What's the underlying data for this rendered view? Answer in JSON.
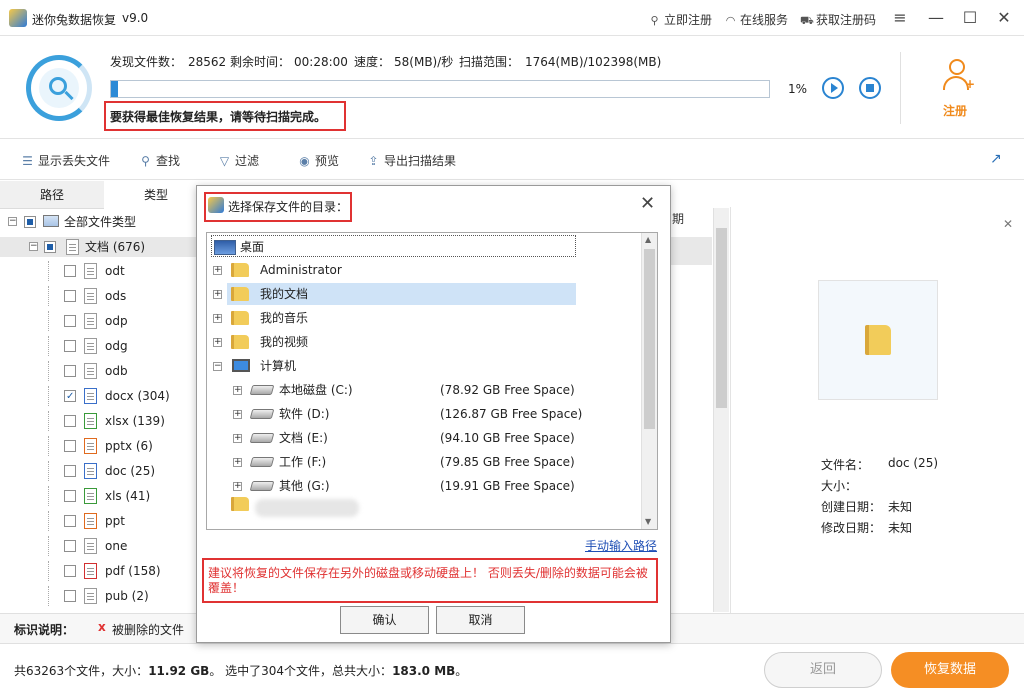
{
  "app": {
    "title": "迷你兔数据恢复",
    "version": "v9.0",
    "links": {
      "register_now": "立即注册",
      "online_service": "在线服务",
      "get_code": "获取注册码"
    },
    "icons": {
      "register": "search-icon",
      "service": "headset-icon",
      "cart": "cart-icon"
    }
  },
  "scan": {
    "found_label": "发现文件数：",
    "found_value": "28562",
    "remaining_label": "剩余时间：",
    "remaining_value": "00:28:00",
    "speed_label": "速度：",
    "speed_value": "58(MB)/秒",
    "range_label": "扫描范围：",
    "range_value": "1764(MB)/102398(MB)",
    "progress": 1,
    "progress_text": "1%",
    "warning": "要获得最佳恢复结果，请等待扫描完成。",
    "register_label": "注册"
  },
  "toolbar": {
    "show_lost": "显示丢失文件",
    "find": "查找",
    "filter": "过滤",
    "preview": "预览",
    "export": "导出扫描结果"
  },
  "tabs": [
    "路径",
    "类型"
  ],
  "tree": {
    "root": "全部文件类型",
    "docs": "文档 (676)",
    "items": [
      {
        "label": "odt",
        "color": "plain",
        "checked": false
      },
      {
        "label": "ods",
        "color": "plain",
        "checked": false
      },
      {
        "label": "odp",
        "color": "plain",
        "checked": false
      },
      {
        "label": "odg",
        "color": "plain",
        "checked": false
      },
      {
        "label": "odb",
        "color": "plain",
        "checked": false
      },
      {
        "label": "docx (304)",
        "color": "blue",
        "checked": true
      },
      {
        "label": "xlsx (139)",
        "color": "green",
        "checked": false
      },
      {
        "label": "pptx (6)",
        "color": "orange",
        "checked": false
      },
      {
        "label": "doc (25)",
        "color": "blue",
        "checked": false
      },
      {
        "label": "xls (41)",
        "color": "green",
        "checked": false
      },
      {
        "label": "ppt",
        "color": "orange",
        "checked": false
      },
      {
        "label": "one",
        "color": "plain",
        "checked": false
      },
      {
        "label": "pdf (158)",
        "color": "red",
        "checked": false
      },
      {
        "label": "pub (2)",
        "color": "plain",
        "checked": false
      }
    ]
  },
  "list": {
    "date_header": "日期"
  },
  "preview": {
    "name_label": "文件名：",
    "name_value": "doc (25)",
    "size_label": "大小：",
    "created_label": "创建日期：",
    "created_value": "未知",
    "modified_label": "修改日期：",
    "modified_value": "未知"
  },
  "legend": {
    "title": "标识说明：",
    "mark": "x",
    "text": "被删除的文件"
  },
  "status": {
    "total_prefix": "共63263个文件，大小：",
    "total_size": "11.92 GB",
    "selected_text": "。 选中了304个文件，总共大小：",
    "selected_size": "183.0 MB",
    "end": "。"
  },
  "buttons": {
    "back": "返回",
    "recover": "恢复数据"
  },
  "colors": {
    "accent": "#2d8ad6",
    "warn": "#e03232",
    "orange": "#f58e24"
  },
  "dialog": {
    "title": "选择保存文件的目录：",
    "desktop": "桌面",
    "admin": "Administrator",
    "my_docs": "我的文档",
    "my_music": "我的音乐",
    "my_videos": "我的视频",
    "computer": "计算机",
    "drives": [
      {
        "name": "本地磁盘 (C:)",
        "free": "(78.92 GB Free Space)"
      },
      {
        "name": "软件 (D:)",
        "free": "(126.87 GB Free Space)"
      },
      {
        "name": "文档 (E:)",
        "free": "(94.10 GB Free Space)"
      },
      {
        "name": "工作 (F:)",
        "free": "(79.85 GB Free Space)"
      },
      {
        "name": "其他 (G:)",
        "free": "(19.91 GB Free Space)"
      }
    ],
    "manual_path": "手动输入路径",
    "tip": "建议将恢复的文件保存在另外的磁盘或移动硬盘上！ 否则丢失/删除的数据可能会被覆盖！",
    "confirm": "确认",
    "cancel": "取消"
  }
}
